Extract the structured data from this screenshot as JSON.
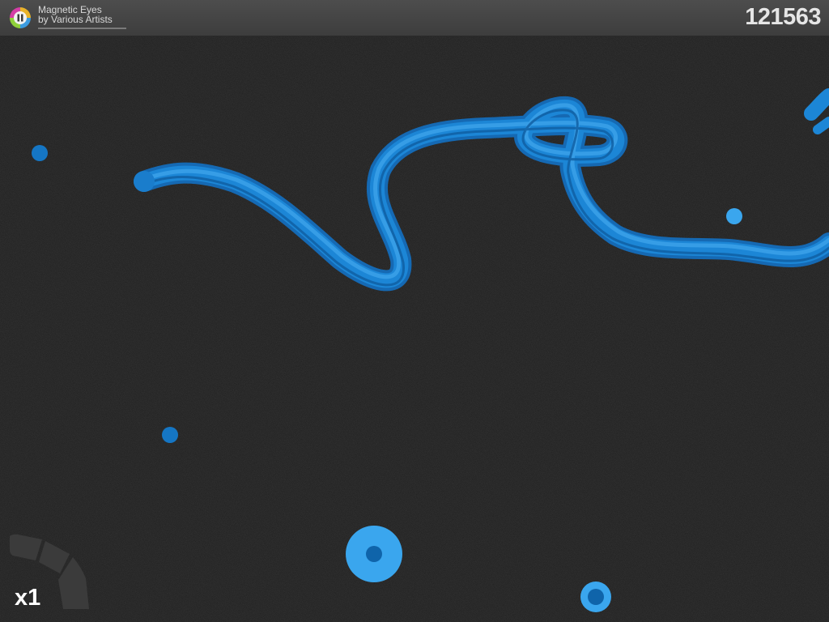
{
  "song": {
    "title": "Magnetic Eyes",
    "artist": "by Various Artists",
    "progress": 1.0
  },
  "score": "121563",
  "multiplier": "x1",
  "icons": {
    "pause": "pause-icon",
    "meter": "combo-meter-icon"
  },
  "colors": {
    "background": "#1c1c1c",
    "topbar": "#454545",
    "ribbon": "#1a7fd0",
    "ribbon_light": "#2f9ae8",
    "dot": "#1576c4",
    "target_outer": "#3aa6ee",
    "target_inner": "#0f64aa",
    "meter_segment": "#3b3b3b"
  }
}
